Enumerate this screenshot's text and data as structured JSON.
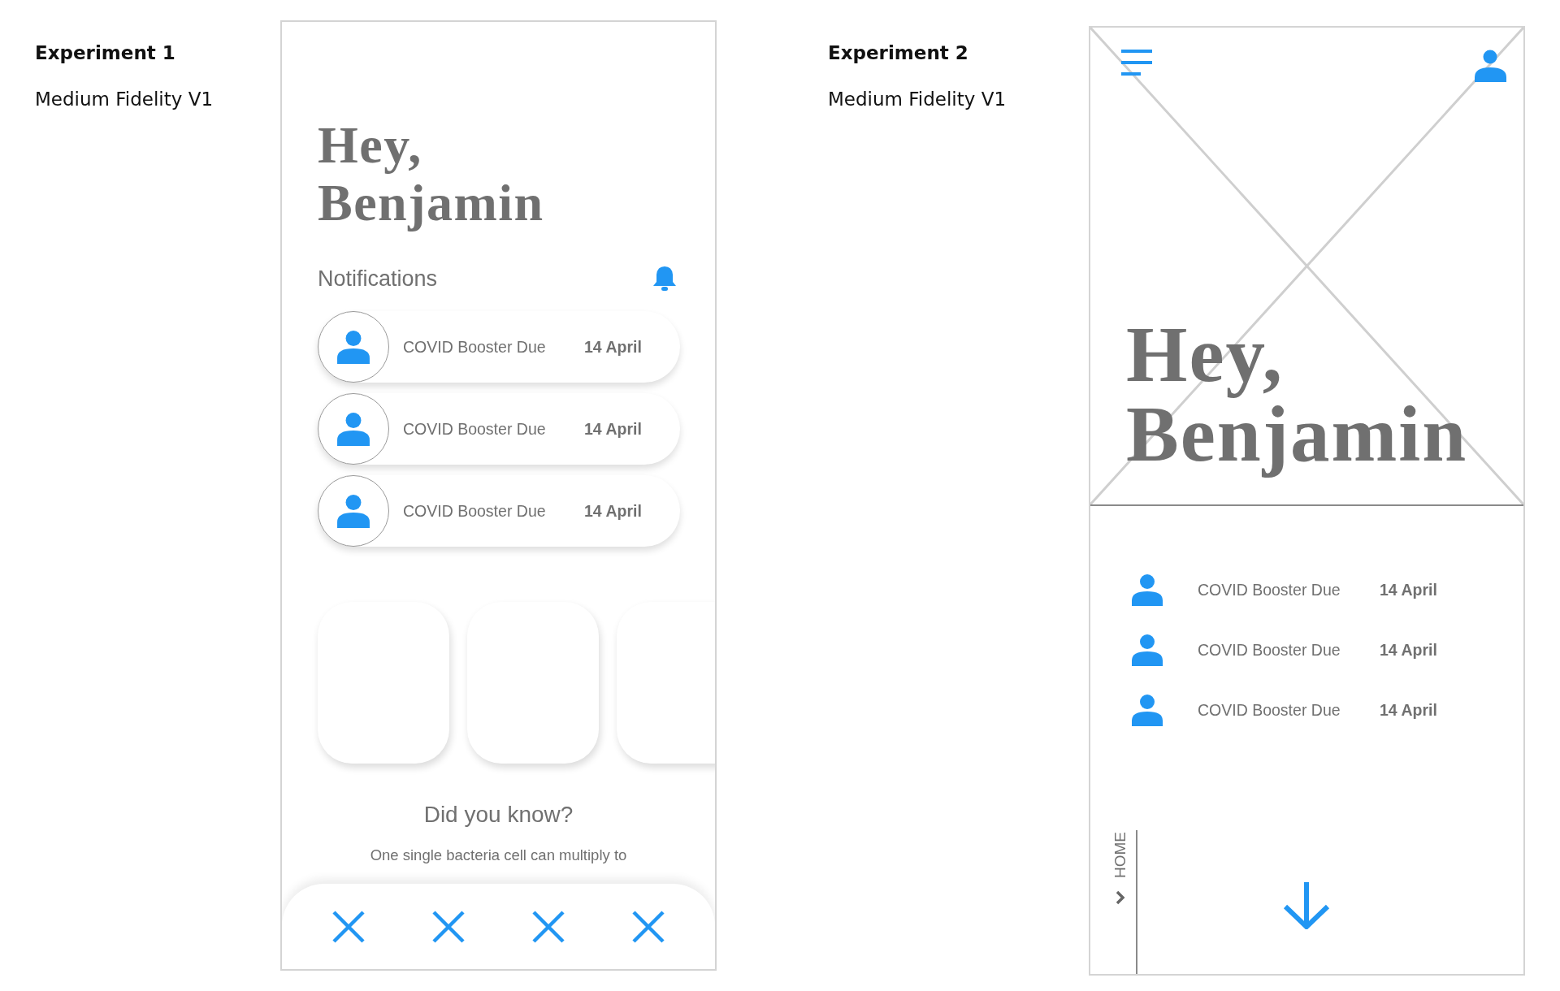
{
  "experiment_1": {
    "title": "Experiment 1",
    "subtitle": "Medium Fidelity V1",
    "screen": {
      "greeting": [
        "Hey,",
        "Benjamin"
      ],
      "notifications_title": "Notifications",
      "notifications": [
        {
          "text": "COVID Booster Due",
          "date": "14 April"
        },
        {
          "text": "COVID Booster Due",
          "date": "14 April"
        },
        {
          "text": "COVID Booster Due",
          "date": "14 April"
        }
      ],
      "cards": [
        {
          "kind": "blank"
        },
        {
          "kind": "blank"
        },
        {
          "kind": "blank"
        }
      ],
      "did_you_know": {
        "title": "Did you know?",
        "text": "One single bacteria cell can multiply to"
      },
      "bottom_nav": [
        {
          "kind": "cross"
        },
        {
          "kind": "cross"
        },
        {
          "kind": "cross"
        },
        {
          "kind": "cross"
        }
      ]
    }
  },
  "experiment_2": {
    "title": "Experiment 2",
    "subtitle": "Medium Fidelity V1",
    "screen": {
      "hero": {
        "kind": "image-placeholder"
      },
      "greeting": [
        "Hey,",
        "Benjamin"
      ],
      "notifications": [
        {
          "text": "COVID Booster Due",
          "date": "14 April"
        },
        {
          "text": "COVID Booster Due",
          "date": "14 April"
        },
        {
          "text": "COVID Booster Due",
          "date": "14 April"
        }
      ],
      "side_nav": {
        "label": "HOME"
      }
    }
  }
}
